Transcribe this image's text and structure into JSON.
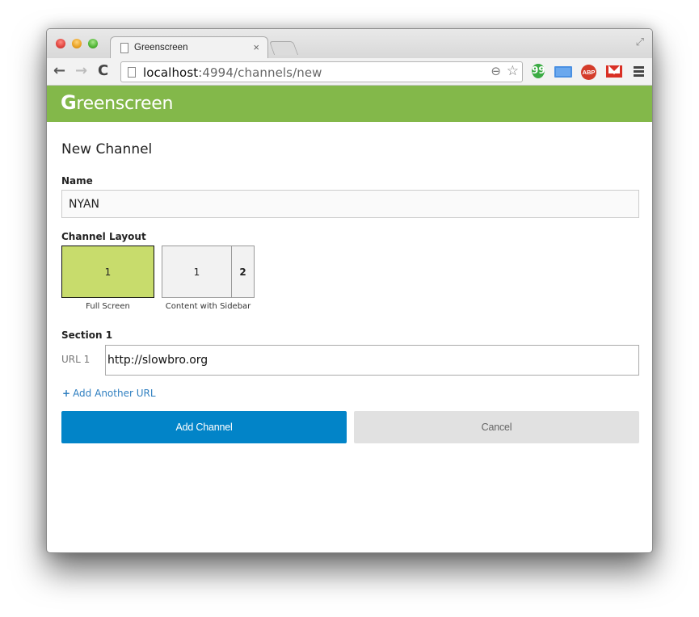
{
  "browser": {
    "tab": {
      "title": "Greenscreen",
      "close_glyph": "×"
    },
    "nav": {
      "back_glyph": "←",
      "forward_glyph": "→",
      "reload_glyph": "C"
    },
    "address": {
      "host": "localhost",
      "rest": ":4994/channels/new"
    },
    "omnibox_icons": {
      "zoom_glyph": "⊖",
      "star_glyph": "☆"
    },
    "extensions": [
      {
        "name": "hangouts-icon",
        "glyph": "99"
      },
      {
        "name": "cast-icon"
      },
      {
        "name": "adblock-plus-icon",
        "glyph": "ABP"
      },
      {
        "name": "gmail-icon"
      }
    ],
    "fullscreen_glyph": "⤢"
  },
  "app": {
    "brand_initial": "G",
    "brand_rest": "reenscreen",
    "brand_color": "#83b84a"
  },
  "form": {
    "title": "New Channel",
    "name_label": "Name",
    "name_value": "NYAN",
    "layout_label": "Channel Layout",
    "layouts": [
      {
        "caption": "Full Screen",
        "panes": [
          "1"
        ],
        "selected": true,
        "selected_color": "#c8dc6c"
      },
      {
        "caption": "Content with Sidebar",
        "panes": [
          "1",
          "2"
        ],
        "selected": false
      }
    ],
    "section_label": "Section 1",
    "url_label": "URL 1",
    "url_value": "http://slowbro.org",
    "add_url_plus": "+",
    "add_url_label": "Add Another URL",
    "submit_label": "Add Channel",
    "cancel_label": "Cancel",
    "primary_color": "#0284c8"
  }
}
